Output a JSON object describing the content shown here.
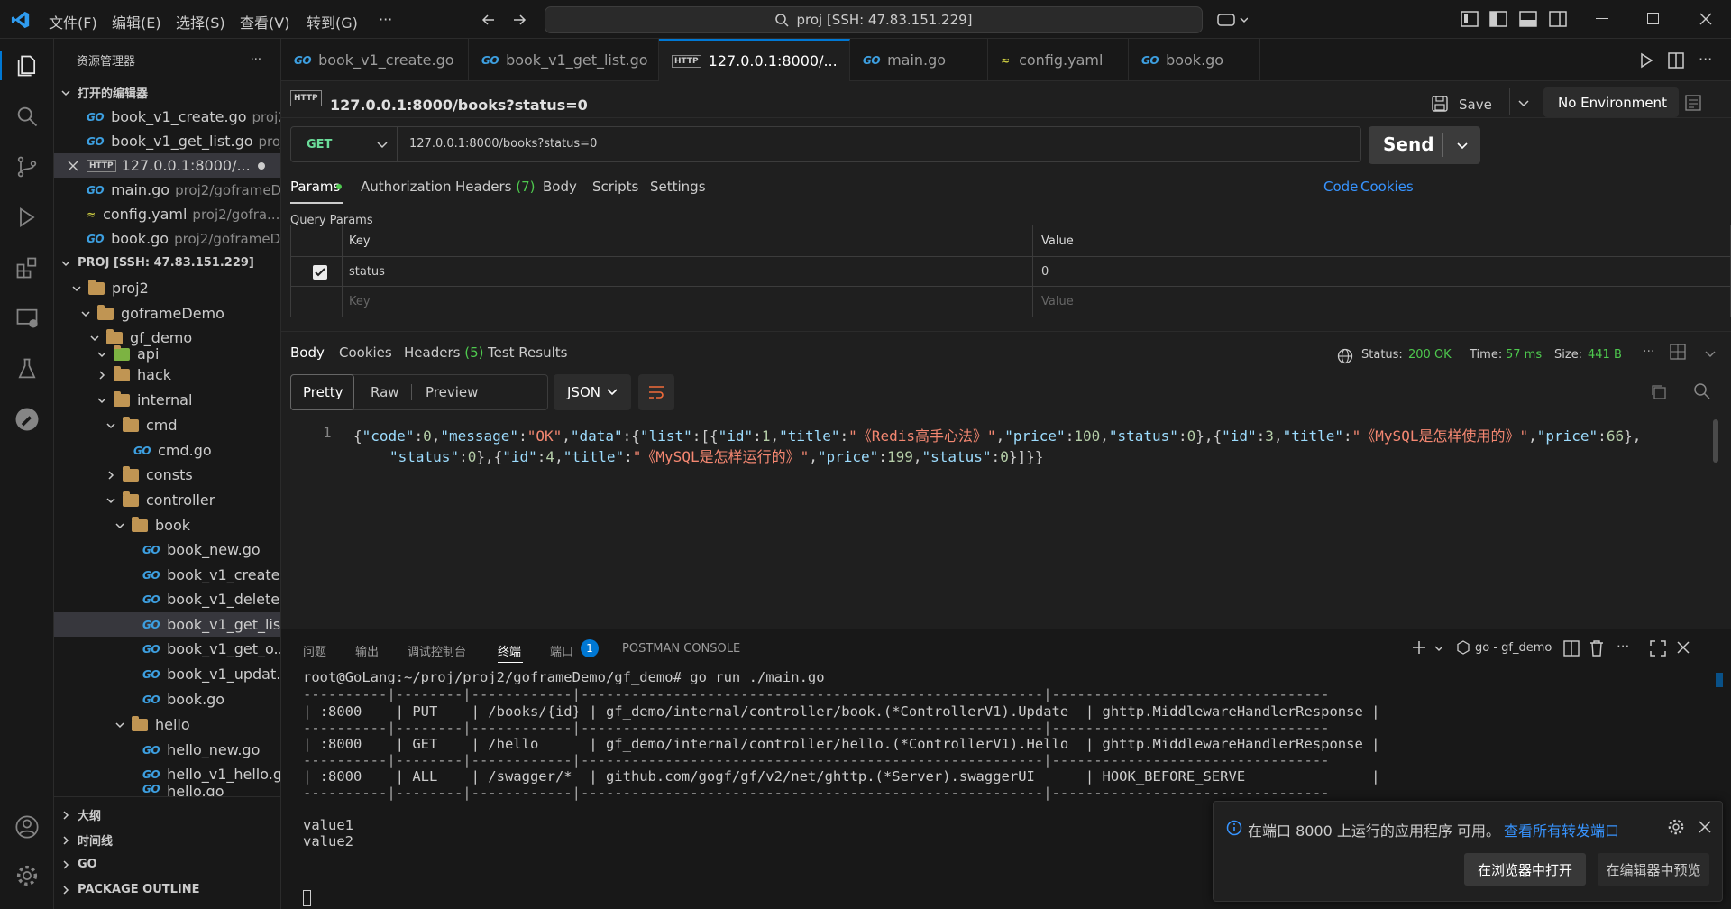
{
  "titlebar": {
    "menus": [
      "文件(F)",
      "编辑(E)",
      "选择(S)",
      "查看(V)",
      "转到(G)",
      "···"
    ],
    "command_center": "proj [SSH: 47.83.151.229]"
  },
  "sidebar": {
    "title": "资源管理器",
    "open_editors_header": "打开的编辑器",
    "open_editors": [
      {
        "name": "book_v1_create.go",
        "path": "proj2..."
      },
      {
        "name": "book_v1_get_list.go",
        "path": "proj..."
      },
      {
        "name": "127.0.0.1:8000/...",
        "path": ""
      },
      {
        "name": "main.go",
        "path": "proj2/goframeD..."
      },
      {
        "name": "config.yaml",
        "path": "proj2/gofra..."
      },
      {
        "name": "book.go",
        "path": "proj2/goframeD..."
      }
    ],
    "workspace_header": "PROJ [SSH: 47.83.151.229]",
    "tree": {
      "proj2": "proj2",
      "goframeDemo": "goframeDemo",
      "gf_demo": "gf_demo",
      "api": "api",
      "hack": "hack",
      "internal": "internal",
      "cmd": "cmd",
      "cmd_go": "cmd.go",
      "consts": "consts",
      "controller": "controller",
      "book": "book",
      "book_new": "book_new.go",
      "book_create": "book_v1_create...",
      "book_delete": "book_v1_delete...",
      "book_get_list": "book_v1_get_lis...",
      "book_get_one": "book_v1_get_o...",
      "book_update": "book_v1_updat...",
      "book_go": "book.go",
      "hello": "hello",
      "hello_new": "hello_new.go",
      "hello_v1": "hello_v1_hello.go",
      "hello_go": "hello.go"
    },
    "bottom_sections": [
      "大纲",
      "时间线",
      "GO",
      "PACKAGE OUTLINE"
    ]
  },
  "tabs": [
    {
      "label": "book_v1_create.go"
    },
    {
      "label": "book_v1_get_list.go"
    },
    {
      "label": "127.0.0.1:8000/..."
    },
    {
      "label": "main.go"
    },
    {
      "label": "config.yaml"
    },
    {
      "label": "book.go"
    }
  ],
  "request": {
    "title": "127.0.0.1:8000/books?status=0",
    "save_label": "Save",
    "environment": "No Environment",
    "method": "GET",
    "url": "127.0.0.1:8000/books?status=0",
    "send_label": "Send",
    "tabs": [
      "Params",
      "Authorization",
      "Headers",
      "(7)",
      "Body",
      "Scripts",
      "Settings"
    ],
    "code_link": "Code",
    "cookies_link": "Cookies",
    "query_params_title": "Query Params",
    "col_key": "Key",
    "col_value": "Value",
    "param_key": "status",
    "param_value": "0",
    "key_placeholder": "Key",
    "value_placeholder": "Value"
  },
  "response": {
    "tabs": [
      "Body",
      "Cookies",
      "Headers",
      "(5)",
      "Test Results"
    ],
    "status_label": "Status:",
    "status_value": "200 OK",
    "time_label": "Time:",
    "time_value": "57 ms",
    "size_label": "Size:",
    "size_value": "441 B",
    "views": [
      "Pretty",
      "Raw",
      "Preview"
    ],
    "format": "JSON",
    "line_number": "1"
  },
  "json_body": {
    "code": 0,
    "message": "OK",
    "list": [
      {
        "id": 1,
        "title": "《Redis高手心法》",
        "price": 100,
        "status": 0
      },
      {
        "id": 3,
        "title": "《MySQL是怎样使用的》",
        "price": 66,
        "status": 0
      },
      {
        "id": 4,
        "title": "《MySQL是怎样运行的》",
        "price": 199,
        "status": 0
      }
    ]
  },
  "panel": {
    "tabs": [
      "问题",
      "输出",
      "调试控制台",
      "终端",
      "端口",
      "POSTMAN CONSOLE"
    ],
    "ports_badge": "1",
    "terminal_name": "go - gf_demo",
    "terminal_lines": [
      "root@GoLang:~/proj/proj2/goframeDemo/gf_demo# go run ./main.go",
      "----------|--------|------------|-------------------------------------------------------|---------------------------------",
      "| :8000    | PUT    | /books/{id} | gf_demo/internal/controller/book.(*ControllerV1).Update  | ghttp.MiddlewareHandlerResponse |",
      "----------|--------|------------|-------------------------------------------------------|---------------------------------",
      "| :8000    | GET    | /hello      | gf_demo/internal/controller/hello.(*ControllerV1).Hello  | ghttp.MiddlewareHandlerResponse |",
      "----------|--------|------------|-------------------------------------------------------|---------------------------------",
      "| :8000    | ALL    | /swagger/*  | github.com/gogf/gf/v2/net/ghttp.(*Server).swaggerUI      | HOOK_BEFORE_SERVE               |",
      "----------|--------|------------|-------------------------------------------------------|---------------------------------",
      "",
      "value1",
      "value2"
    ]
  },
  "notification": {
    "message": "在端口 8000 上运行的应用程序 可用。",
    "link": "查看所有转发端口",
    "primary": "在浏览器中打开",
    "secondary": "在编辑器中预览"
  },
  "colors": {
    "accent": "#0078d4",
    "status_ok": "#4ec94e",
    "link": "#3794ff",
    "string": "#f48771",
    "key": "#9cdcfe",
    "number": "#b5cea8"
  }
}
